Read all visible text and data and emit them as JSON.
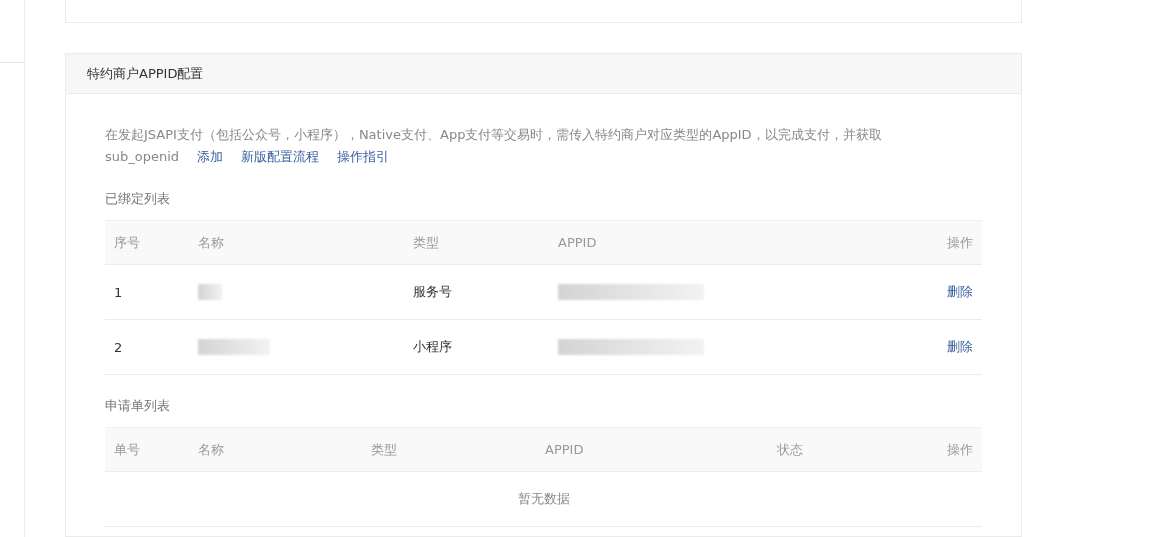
{
  "section": {
    "title": "特约商户APPID配置",
    "description_lines": [
      "在发起JSAPI支付（包括公众号，小程序），Native支付、App支付等交易时，需传入特约商户对应类型的AppID，以完成支付，并获取",
      "sub_openid"
    ],
    "links": [
      "添加",
      "新版配置流程",
      "操作指引"
    ]
  },
  "bound_table": {
    "title": "已绑定列表",
    "columns": [
      "序号",
      "名称",
      "类型",
      "APPID",
      "操作"
    ],
    "rows": [
      {
        "index": "1",
        "name_redacted": true,
        "type": "服务号",
        "appid_redacted": true,
        "action": "删除"
      },
      {
        "index": "2",
        "name_redacted": true,
        "type": "小程序",
        "appid_redacted": true,
        "action": "删除"
      }
    ]
  },
  "application_table": {
    "title": "申请单列表",
    "columns": [
      "单号",
      "名称",
      "类型",
      "APPID",
      "状态",
      "操作"
    ],
    "empty_text": "暂无数据"
  }
}
